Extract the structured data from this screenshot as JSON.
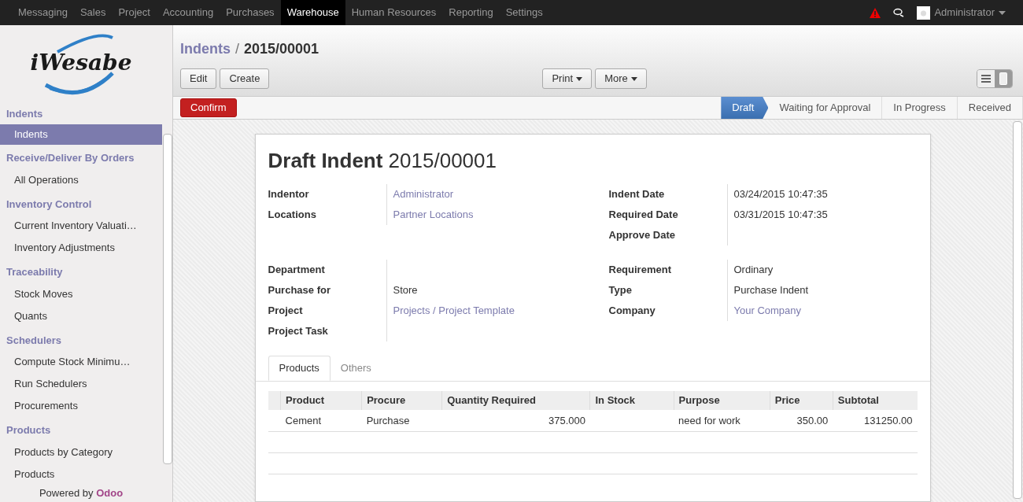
{
  "top_menu": [
    {
      "label": "Messaging",
      "selected": false
    },
    {
      "label": "Sales",
      "selected": false
    },
    {
      "label": "Project",
      "selected": false
    },
    {
      "label": "Accounting",
      "selected": false
    },
    {
      "label": "Purchases",
      "selected": false
    },
    {
      "label": "Warehouse",
      "selected": true
    },
    {
      "label": "Human Resources",
      "selected": false
    },
    {
      "label": "Reporting",
      "selected": false
    },
    {
      "label": "Settings",
      "selected": false
    }
  ],
  "user": {
    "name": "Administrator"
  },
  "logo": {
    "text": "iWesabe"
  },
  "sidebar": {
    "sections": [
      {
        "title": "Indents",
        "items": [
          {
            "label": "Indents",
            "selected": true
          }
        ]
      },
      {
        "title": "Receive/Deliver By Orders",
        "items": [
          {
            "label": "All Operations",
            "selected": false
          }
        ]
      },
      {
        "title": "Inventory Control",
        "items": [
          {
            "label": "Current Inventory Valuati…",
            "selected": false
          },
          {
            "label": "Inventory Adjustments",
            "selected": false
          }
        ]
      },
      {
        "title": "Traceability",
        "items": [
          {
            "label": "Stock Moves",
            "selected": false
          },
          {
            "label": "Quants",
            "selected": false
          }
        ]
      },
      {
        "title": "Schedulers",
        "items": [
          {
            "label": "Compute Stock Minimu…",
            "selected": false
          },
          {
            "label": "Run Schedulers",
            "selected": false
          },
          {
            "label": "Procurements",
            "selected": false
          }
        ]
      },
      {
        "title": "Products",
        "items": [
          {
            "label": "Products by Category",
            "selected": false
          },
          {
            "label": "Products",
            "selected": false
          }
        ]
      }
    ],
    "footer": {
      "prefix": "Powered by",
      "brand": "Odoo"
    }
  },
  "breadcrumb": {
    "parent": "Indents",
    "separator": "/",
    "current": "2015/00001"
  },
  "buttons_left": [
    "Edit",
    "Create"
  ],
  "buttons_center": [
    "Print",
    "More"
  ],
  "view_switch": [
    {
      "kind": "list",
      "selected": false
    },
    {
      "kind": "form",
      "selected": true
    }
  ],
  "confirm_button": "Confirm",
  "stages": [
    {
      "label": "Draft",
      "selected": true
    },
    {
      "label": "Waiting for Approval",
      "selected": false
    },
    {
      "label": "In Progress",
      "selected": false
    },
    {
      "label": "Received",
      "selected": false
    }
  ],
  "form": {
    "title_prefix": "Draft Indent",
    "title_number": "2015/00001",
    "groups": [
      {
        "left": [
          {
            "label": "Indentor",
            "value": "Administrator",
            "kind": "link"
          },
          {
            "label": "Locations",
            "value": "Partner Locations",
            "kind": "link"
          }
        ],
        "right": [
          {
            "label": "Indent Date",
            "value": "03/24/2015 10:47:35",
            "kind": "text"
          },
          {
            "label": "Required Date",
            "value": "03/31/2015 10:47:35",
            "kind": "text"
          },
          {
            "label": "Approve Date"
          }
        ]
      },
      {
        "left": [
          {
            "label": "Department"
          },
          {
            "label": "Purchase for",
            "value": "Store",
            "kind": "text"
          },
          {
            "label": "Project",
            "value": "Projects / Project Template",
            "kind": "link"
          },
          {
            "label": "Project Task"
          }
        ],
        "right": [
          {
            "label": "Requirement",
            "value": "Ordinary",
            "kind": "text"
          },
          {
            "label": "Type",
            "value": "Purchase Indent",
            "kind": "text"
          },
          {
            "label": "Company",
            "value": "Your Company",
            "kind": "link"
          }
        ]
      }
    ],
    "tabs": [
      {
        "label": "Products",
        "selected": true
      },
      {
        "label": "Others",
        "selected": false
      }
    ],
    "table": {
      "columns": [
        "Product",
        "Procure",
        "Quantity Required",
        "In Stock",
        "Purpose",
        "Price",
        "Subtotal"
      ],
      "rows": [
        [
          "Cement",
          "Purchase",
          "375.000",
          "",
          "need for work",
          "350.00",
          "131250.00"
        ]
      ]
    }
  }
}
